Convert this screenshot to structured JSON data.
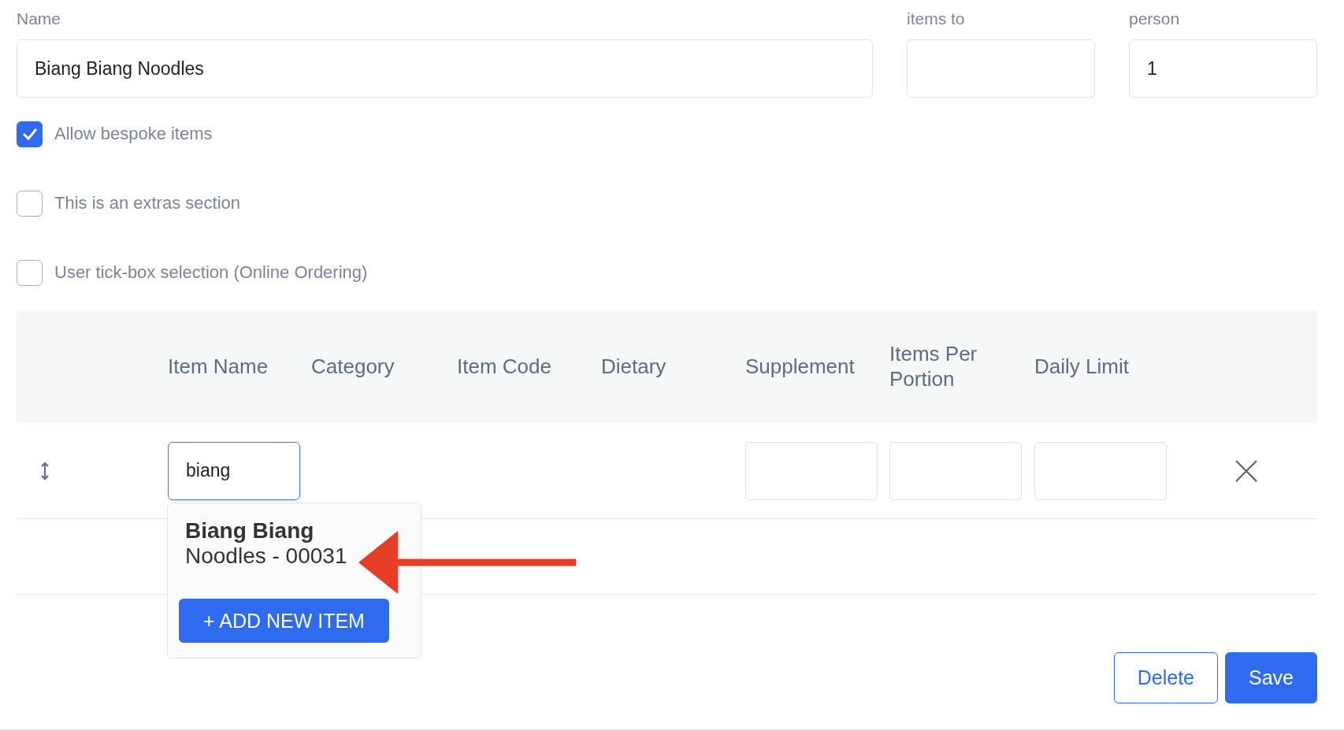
{
  "name_field": {
    "label": "Name",
    "value": "Biang Biang Noodles"
  },
  "fields": [
    {
      "label": "items to"
    },
    {
      "label": "person",
      "value": "1"
    }
  ],
  "checkboxes": [
    {
      "label": "Allow bespoke items",
      "checked": true
    },
    {
      "label": "This is an extras section",
      "checked": false
    },
    {
      "label": "User tick-box selection (Online Ordering)",
      "checked": false
    }
  ],
  "table": {
    "columns": [
      "Item Name",
      "Category",
      "Item Code",
      "Dietary",
      "Supplement",
      "Items Per Portion",
      "Daily Limit"
    ],
    "rows": [
      {
        "item_name": "biang",
        "focused": true,
        "suggestions": [
          "**Biang Biang** Noodles - 00031"
        ],
        "add_button": "+ ADD NEW ITEM"
      }
    ]
  },
  "buttons": [
    {
      "label": "Delete",
      "kind": "secondary"
    },
    {
      "label": "Save",
      "kind": "primary"
    }
  ]
}
